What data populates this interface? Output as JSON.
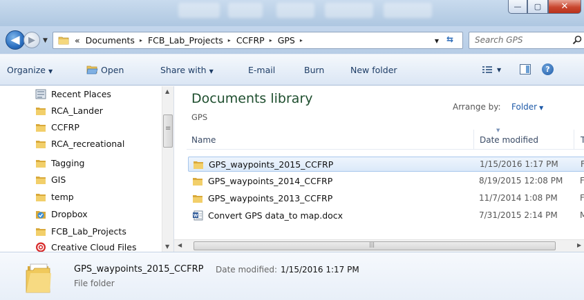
{
  "window": {
    "minimize_glyph": "—",
    "maximize_glyph": "▢",
    "close_glyph": "✕"
  },
  "nav": {
    "back_glyph": "◀",
    "forward_glyph": "▶",
    "history_glyph": "▼",
    "refresh_glyph": "⇆"
  },
  "address": {
    "overflow": "«",
    "crumbs": [
      "Documents",
      "FCB_Lab_Projects",
      "CCFRP",
      "GPS"
    ],
    "separator": "▸",
    "dropdown_glyph": "▼"
  },
  "search": {
    "placeholder": "Search GPS"
  },
  "toolbar": {
    "organize": "Organize",
    "open": "Open",
    "share_with": "Share with",
    "email": "E-mail",
    "burn": "Burn",
    "new_folder": "New folder",
    "dropdown_glyph": "▼",
    "help_glyph": "?"
  },
  "navpane": {
    "items": [
      {
        "label": "Recent Places",
        "icon": "recent-places-icon"
      },
      {
        "label": "RCA_Lander",
        "icon": "folder-icon"
      },
      {
        "label": "CCFRP",
        "icon": "folder-icon"
      },
      {
        "label": "RCA_recreational",
        "icon": "folder-icon"
      },
      {
        "label": "Tagging",
        "icon": "folder-icon"
      },
      {
        "label": "GIS",
        "icon": "folder-icon"
      },
      {
        "label": "temp",
        "icon": "folder-icon"
      },
      {
        "label": "Dropbox",
        "icon": "dropbox-icon"
      },
      {
        "label": "FCB_Lab_Projects",
        "icon": "folder-icon"
      },
      {
        "label": "Creative Cloud Files",
        "icon": "creative-cloud-icon"
      }
    ]
  },
  "library": {
    "title": "Documents library",
    "subtitle": "GPS",
    "arrange_label": "Arrange by:",
    "arrange_value": "Folder"
  },
  "columns": {
    "name": "Name",
    "date_modified": "Date modified",
    "type": "T"
  },
  "files": [
    {
      "name": "GPS_waypoints_2015_CCFRP",
      "date": "1/15/2016 1:17 PM",
      "type": "F",
      "icon": "folder-icon",
      "selected": true
    },
    {
      "name": "GPS_waypoints_2014_CCFRP",
      "date": "8/19/2015 12:08 PM",
      "type": "F",
      "icon": "folder-icon",
      "selected": false
    },
    {
      "name": "GPS_waypoints_2013_CCFRP",
      "date": "11/7/2014 1:08 PM",
      "type": "F",
      "icon": "folder-icon",
      "selected": false
    },
    {
      "name": "Convert GPS data_to map.docx",
      "date": "7/31/2015 2:14 PM",
      "type": "M",
      "icon": "word-document-icon",
      "selected": false
    }
  ],
  "details": {
    "name": "GPS_waypoints_2015_CCFRP",
    "date_label": "Date modified:",
    "date_value": "1/15/2016 1:17 PM",
    "type": "File folder"
  },
  "scroll": {
    "up": "▲",
    "down": "▼",
    "left": "◀",
    "right": "▶"
  },
  "colors": {
    "accent": "#1e5aa8",
    "selection": "#dbe9f9",
    "library_title": "#1e4e2e"
  }
}
